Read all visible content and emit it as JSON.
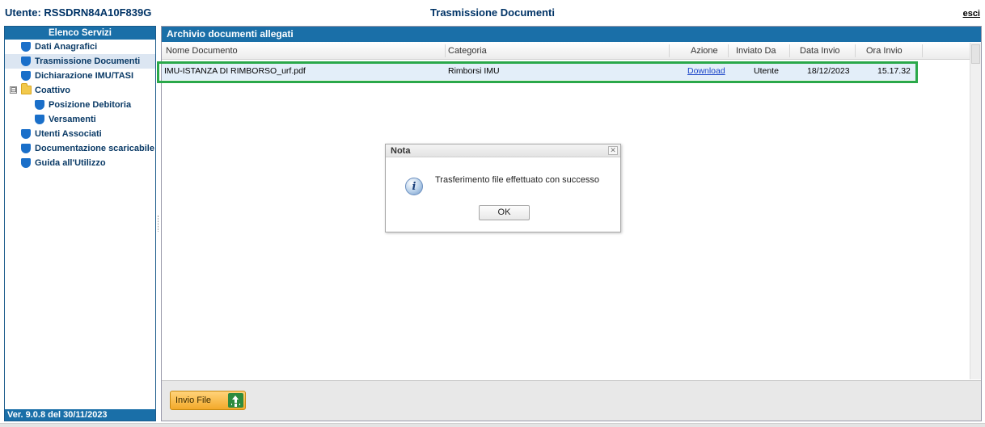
{
  "header": {
    "user_label": "Utente: RSSDRN84A10F839G",
    "title": "Trasmissione Documenti",
    "logout_label": "esci"
  },
  "sidebar": {
    "title": "Elenco Servizi",
    "items": [
      {
        "label": "Dati Anagrafici",
        "icon": "shield-icon"
      },
      {
        "label": "Trasmissione Documenti",
        "icon": "shield-icon",
        "active": true
      },
      {
        "label": "Dichiarazione IMU/TASI",
        "icon": "shield-icon"
      },
      {
        "label": "Coattivo",
        "icon": "folder-icon",
        "toggle": "⊟",
        "children": [
          {
            "label": "Posizione Debitoria",
            "icon": "shield-icon"
          },
          {
            "label": "Versamenti",
            "icon": "shield-icon"
          }
        ]
      },
      {
        "label": "Utenti Associati",
        "icon": "shield-icon"
      },
      {
        "label": "Documentazione scaricabile",
        "icon": "shield-icon"
      },
      {
        "label": "Guida all'Utilizzo",
        "icon": "shield-icon"
      }
    ],
    "version": "Ver. 9.0.8 del 30/11/2023"
  },
  "panel": {
    "title": "Archivio documenti allegati",
    "columns": [
      "Nome Documento",
      "Categoria",
      "Azione",
      "Inviato Da",
      "Data Invio",
      "Ora Invio"
    ],
    "rows": [
      {
        "name": "IMU-ISTANZA DI RIMBORSO_urf.pdf",
        "category": "Rimborsi IMU",
        "action": "Download",
        "sent_by": "Utente",
        "date": "18/12/2023",
        "time": "15.17.32"
      }
    ],
    "upload_label": "Invio File"
  },
  "dialog": {
    "title": "Nota",
    "close_glyph": "✕",
    "message": "Trasferimento file effettuato con successo",
    "ok_label": "OK",
    "icon_glyph": "i"
  },
  "colors": {
    "header_blue": "#1a6fa8",
    "row_highlight": "#2aa84a",
    "upload_button": "#f3a92a"
  }
}
